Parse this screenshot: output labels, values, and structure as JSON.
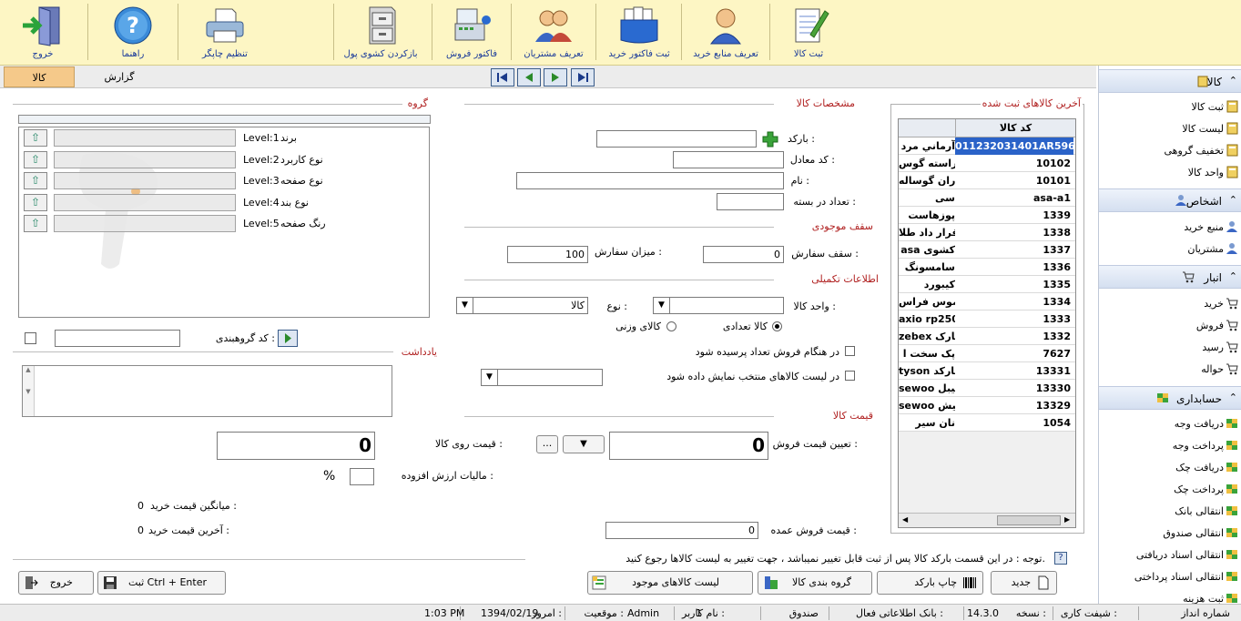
{
  "toolbar": {
    "register_goods": "ثبت کالا",
    "define_suppliers": "تعریف منابع خرید",
    "register_purchase_invoice": "ثبت فاکتور خرید",
    "define_customers": "تعریف مشتریان",
    "sales_invoice": "فاکتور فروش",
    "open_cash_drawer": "بازکردن کشوی پول",
    "printer_settings": "تنظیم چاپگر",
    "help": "راهنما",
    "exit": "خروج"
  },
  "tabs": {
    "goods": "کالا",
    "report": "گزارش"
  },
  "goods_spec": {
    "title": "مشخصات کالا",
    "barcode_label": "بارکد :",
    "barcode_value": "",
    "equiv_code_label": "کد معادل :",
    "name_label": "نام :",
    "qty_in_pack_label": "تعداد در بسته :"
  },
  "stock": {
    "title": "سقف موجودی",
    "order_ceiling_label": "سقف سفارش :",
    "order_ceiling_value": "0",
    "order_amount_label": "میزان سفارش :",
    "order_amount_value": "100"
  },
  "extra": {
    "title": "اطلاعات تکمیلی",
    "unit_label": "واحد کالا :",
    "type_label": "نوع :",
    "type_value": "کالا",
    "count_radio": "کالا تعدادی",
    "weight_radio": "کالای وزنی",
    "ask_qty_check": "در هنگام فروش تعداد پرسیده شود",
    "show_selected_check": "در لیست کالاهای منتخب نمایش داده شود"
  },
  "price": {
    "title": "قیمت کالا",
    "set_sale_price_label": "تعیین قیمت فروش :",
    "set_sale_price_value": "0",
    "more_button": "...",
    "wholesale_label": "قیمت فروش عمده :",
    "wholesale_value": "0",
    "face_price_label": "قیمت روی کالا :",
    "face_price_value": "0",
    "vat_label": "مالیات ارزش افزوده :",
    "vat_unit": "%",
    "avg_buy_label": "میانگین قیمت خرید :",
    "avg_buy_value": "0",
    "last_buy_label": "آخرین قیمت خرید :",
    "last_buy_value": "0"
  },
  "group": {
    "title": "گروه",
    "levels": [
      {
        "name": "برند",
        "level": "Level:1"
      },
      {
        "name": "نوع کاربرد",
        "level": "Level:2"
      },
      {
        "name": "نوع صفحه",
        "level": "Level:3"
      },
      {
        "name": "نوع بند",
        "level": "Level:4"
      },
      {
        "name": "رنگ صفحه",
        "level": "Level:5"
      }
    ],
    "group_code_label": "کد گروهبندی :"
  },
  "notes": {
    "title": "یادداشت"
  },
  "latest": {
    "title": "آخرین کالاهای ثبت شده",
    "col_code": "کد کالا",
    "rows": [
      {
        "code": "011232031401AR596",
        "name": "آرماني مرد"
      },
      {
        "code": "10102",
        "name": "راسته گوس"
      },
      {
        "code": "10101",
        "name": "ران گوساله"
      },
      {
        "code": "asa-a1",
        "name": "سی"
      },
      {
        "code": "1339",
        "name": "پوزهاست"
      },
      {
        "code": "1338",
        "name": "قرار داد طلا"
      },
      {
        "code": "1337",
        "name": "asa کشوی"
      },
      {
        "code": "1336",
        "name": "سامسونگ"
      },
      {
        "code": "1335",
        "name": "کیبورد"
      },
      {
        "code": "1334",
        "name": "موس فراس"
      },
      {
        "code": "1333",
        "name": "axio rp250"
      },
      {
        "code": "1332",
        "name": "zebex بارک"
      },
      {
        "code": "7627",
        "name": "پک سخت ا"
      },
      {
        "code": "13331",
        "name": "tyson بارکد"
      },
      {
        "code": "13330",
        "name": "sewoo لیبل"
      },
      {
        "code": "13329",
        "name": "sewoo فیش"
      },
      {
        "code": "1054",
        "name": "نان سیر"
      }
    ]
  },
  "note_text": "توجه : در این قسمت بارکد کالا پس از ثبت قابل تغییر نمیباشد ، جهت تغییر به لیست کالاها رجوع کنید.",
  "buttons": {
    "new": "جدید",
    "print_barcode": "چاپ بارکد",
    "group_goods": "گروه بندی کالا",
    "stock_list": "لیست کالاهای موجود",
    "save": "ثبت   Ctrl + Enter",
    "exit": "خروج"
  },
  "sidebar": {
    "goods_header": "کالا",
    "goods_items": [
      "ثبت کالا",
      "لیست کالا",
      "تخفیف گروهی",
      "واحد کالا"
    ],
    "persons_header": "اشخاص",
    "persons_items": [
      "منبع خرید",
      "مشتریان"
    ],
    "store_header": "انبار",
    "store_items": [
      "خرید",
      "فروش",
      "رسید",
      "حواله"
    ],
    "acct_header": "حسابداری",
    "acct_items": [
      "دریافت وجه",
      "پرداخت وجه",
      "دریافت چک",
      "پرداخت چک",
      "انتقالی بانک",
      "انتقالی صندوق",
      "انتقالی اسناد دریافتی",
      "انتقالی اسناد پرداختی",
      "ثبت هزینه"
    ]
  },
  "status": {
    "savings_no": "شماره انداز",
    "shift": "شیفت کاری :",
    "version_label": "نسخه :",
    "version": "14.3.0",
    "active_bank": "بانک اطلاعاتی فعال :",
    "cash": "صندوق",
    "user_label": "نام کاربر :",
    "user_num": "1",
    "location_label": "موقعیت :",
    "user": "Admin",
    "today_label": "امروز :",
    "date": "1394/02/19",
    "time": "1:03 PM"
  }
}
